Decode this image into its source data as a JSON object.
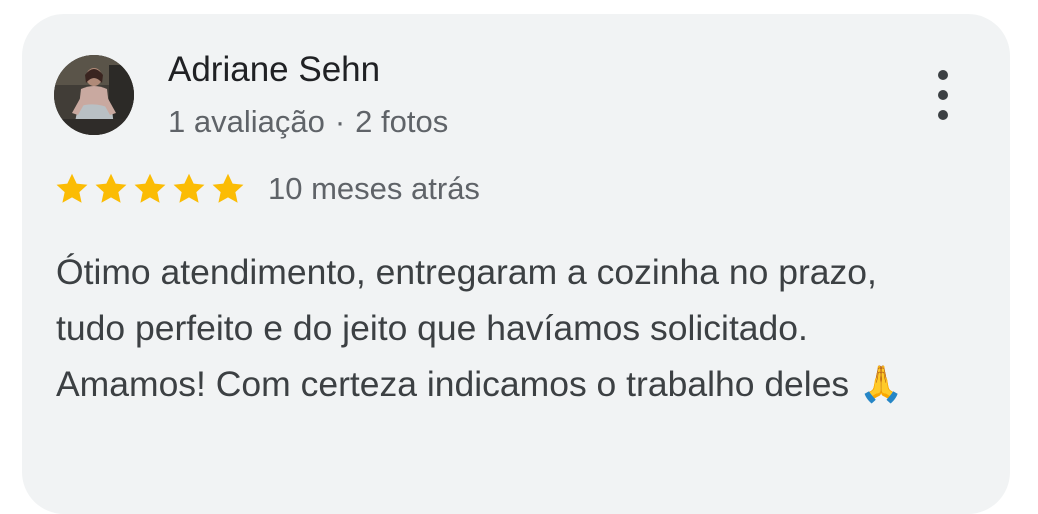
{
  "review": {
    "author": "Adriane Sehn",
    "reviews_count": "1 avaliação",
    "separator": "·",
    "photos_count": "2 fotos",
    "rating": 5,
    "rating_max": 5,
    "time_ago": "10 meses atrás",
    "text": "Ótimo atendimento, entregaram a cozinha no prazo, tudo perfeito e do jeito que havíamos solicitado. Amamos! Com certeza indicamos o trabalho deles 🙏"
  },
  "icons": {
    "more": "more-vert-icon",
    "star": "star-icon",
    "avatar": "profile-photo"
  },
  "colors": {
    "card_background": "#f1f3f4",
    "star": "#fbbc04",
    "name": "#202124",
    "secondary_text": "#5f6368",
    "body_text": "#3c4043"
  }
}
